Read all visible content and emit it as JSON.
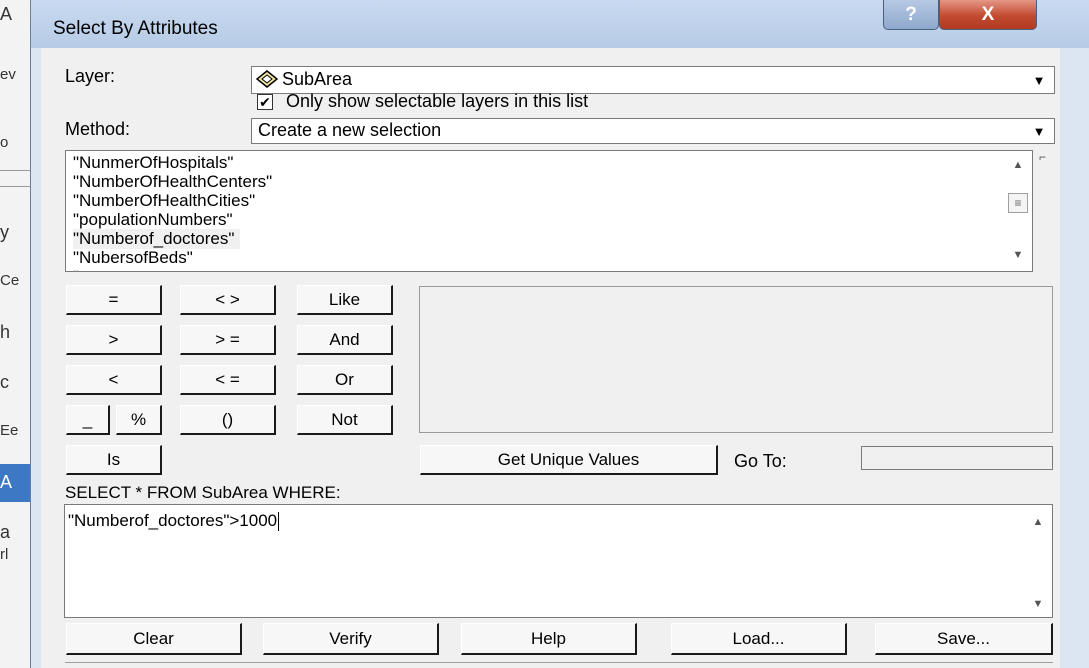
{
  "background_app": {
    "fragments": [
      "A",
      "ev",
      "o",
      "y",
      "Ce",
      "h",
      "c",
      "Ee",
      "A",
      "a",
      "rl"
    ]
  },
  "window": {
    "title": "Select By Attributes",
    "help_glyph": "?",
    "close_glyph": "X"
  },
  "layer": {
    "label": "Layer:",
    "value": "SubArea",
    "dropdown_arrow": "▼",
    "only_selectable_checked_mark": "✔",
    "only_selectable_label": "Only show selectable layers in this list"
  },
  "method": {
    "label": "Method:",
    "value": "Create a new selection",
    "dropdown_arrow": "▼"
  },
  "fields": {
    "items": [
      "\"NunmerOfHospitals\"",
      "\"NumberOfHealthCenters\"",
      "\"NumberOfHealthCities\"",
      "\"populationNumbers\"",
      "\"Numberof_doctores\"",
      "\"NubersofBeds\""
    ],
    "selected_index": 4,
    "scroll_up": "▲",
    "scroll_down": "▼",
    "thumb_glyph": "≡",
    "resize_glyph": "⌐"
  },
  "operators": {
    "eq": "=",
    "neq": "< >",
    "like": "Like",
    "gt": ">",
    "gte": "> =",
    "and": "And",
    "lt": "<",
    "lte": "< =",
    "or": "Or",
    "underscore": "_",
    "percent": "%",
    "parens": "()",
    "not": "Not",
    "is": "Is"
  },
  "unique_values": {
    "button": "Get Unique Values",
    "goto_label": "Go To:",
    "goto_value": ""
  },
  "query": {
    "prefix": "SELECT * FROM SubArea WHERE:",
    "expression": "\"Numberof_doctores\">1000",
    "scroll_up": "▲",
    "scroll_down": "▼"
  },
  "actions": {
    "clear": "Clear",
    "verify": "Verify",
    "help": "Help",
    "load": "Load...",
    "save": "Save..."
  }
}
